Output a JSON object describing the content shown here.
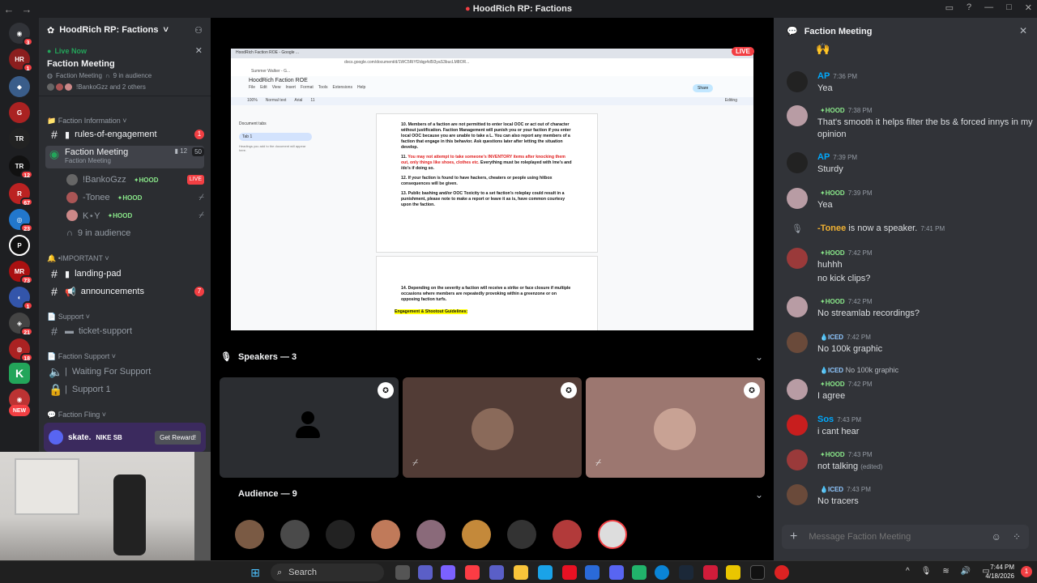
{
  "window": {
    "title": "HoodRich RP: Factions",
    "logo": "mic"
  },
  "server": {
    "name": "HoodRich RP: Factions",
    "chevron": "˅"
  },
  "live": {
    "label": "Live Now",
    "title": "Faction Meeting",
    "channel": "Faction Meeting",
    "audience": "9 in audience",
    "others": "!BankoGzz and 2 others"
  },
  "categories": {
    "faction_info": "Faction Information",
    "important": "•IMPORTANT",
    "support": "Support",
    "faction_support": "Faction Support",
    "faction_fling": "Faction Fling"
  },
  "channels": {
    "rules": {
      "name": "rules-of-engagement",
      "badge": "1"
    },
    "meeting": {
      "name": "Faction Meeting",
      "sub": "Faction Meeting",
      "count1": "12",
      "count2": "50"
    },
    "landing": {
      "name": "landing-pad"
    },
    "announcements": {
      "name": "announcements",
      "badge": "7"
    },
    "ticket": {
      "name": "ticket-support"
    },
    "waiting": {
      "name": "Waiting For Support"
    },
    "support1": {
      "name": "Support 1"
    }
  },
  "voice_users": [
    {
      "name": "!BankoGzz",
      "tag": "HOOD",
      "badge": "LIVE"
    },
    {
      "name": "-Tonee",
      "tag": "HOOD"
    },
    {
      "name": "K⋆Y",
      "tag": "HOOD"
    }
  ],
  "voice_audience": "9 in audience",
  "promo": {
    "brand": "skate.",
    "partner": "NIKE SB",
    "button": "Get Reward!"
  },
  "rail_badges": [
    "3",
    "1",
    "12",
    "67",
    "23",
    "73",
    "1",
    "21",
    "18",
    "NEW"
  ],
  "stage": {
    "live_badge": "LIVE",
    "speakers_label": "Speakers — 3",
    "audience_label": "Audience — 9"
  },
  "doc": {
    "url": "docs.google.com/document/d/1WC5RiYf2dqp4d5l3yaS3bucLM8OR...",
    "tab": "HoodRich Faction ROE - Google ...",
    "bookmark": "Summer Walker - G...",
    "title": "HoodRich Faction ROE",
    "menu": [
      "File",
      "Edit",
      "View",
      "Insert",
      "Format",
      "Tools",
      "Extensions",
      "Help"
    ],
    "share": "Share",
    "editing": "Editing",
    "zoom": "100%",
    "style": "Normal text",
    "font": "Arial",
    "fontsize": "11",
    "sidebar_title": "Document tabs",
    "sidebar_tab": "Tab 1",
    "sidebar_note": "Headings you add to the document will appear here.",
    "items": [
      {
        "n": "10.",
        "t": "Members of a faction are not permitted to enter local OOC or act out of character without justification. Faction Management will punish you or your faction if you enter local OOC because you are unable to take a L. You can also report any members of a faction that engage in this behavior. Ask questions later after letting the situation develop.",
        "red": ""
      },
      {
        "n": "11.",
        "red": "You may not attempt to take someone's INVENTORY items after knocking them out, only things like shoes, clothes etc.",
        "t": " Everything must be roleplayed with /me's and /do's if doing so."
      },
      {
        "n": "12.",
        "t": "If your faction is found to have hackers, cheaters or people using hitbox consequences will be given.",
        "red": ""
      },
      {
        "n": "13.",
        "t": "Public bashing and/or OOC Toxicity to a set faction's roleplay could result in a punishment, please note to make a report or leave it as is, have common courtesy upon the faction.",
        "red": ""
      },
      {
        "n": "14.",
        "t": "Depending on the severity a faction will receive a strike or face closure if multiple occasions where members are repeatedly provoking within a greenzone or on opposing faction turfs.",
        "red": ""
      }
    ],
    "heading": "Engagement & Shootout Guidelines:"
  },
  "chat": {
    "title": "Faction Meeting",
    "input_placeholder": "Message Faction Meeting",
    "messages": [
      {
        "name": "AP",
        "time": "7:36 PM",
        "text": "Yea",
        "color": "#00a8fc"
      },
      {
        "name": "",
        "tag": "HOOD",
        "time": "7:38 PM",
        "text": "That's smooth it helps filter the bs & forced innys in my opinion"
      },
      {
        "name": "AP",
        "time": "7:39 PM",
        "text": "Sturdy",
        "color": "#00a8fc"
      },
      {
        "name": "",
        "tag": "HOOD",
        "time": "7:39 PM",
        "text": "Yea"
      },
      {
        "name": "-Tonee",
        "text": " is now a speaker.",
        "time": "7:41 PM"
      },
      {
        "name": "",
        "tag": "HOOD",
        "time": "7:42 PM",
        "text": "huhhh",
        "text2": "no kick clips?"
      },
      {
        "name": "",
        "tag": "HOOD",
        "time": "7:42 PM",
        "text": "No streamlab recordings?"
      },
      {
        "name": "",
        "tag": "ICED",
        "time": "7:42 PM",
        "text": "No 100k graphic"
      },
      {
        "reply_tag": "ICED",
        "reply_text": "No 100k graphic",
        "name": "",
        "tag": "HOOD",
        "time": "7:42 PM",
        "text": "I agree"
      },
      {
        "name": "Sos",
        "time": "7:43 PM",
        "text": "i cant hear",
        "color": "#00a8fc"
      },
      {
        "name": "",
        "tag": "HOOD",
        "time": "7:43 PM",
        "text": "not talking",
        "edited": "(edited)"
      },
      {
        "name": "",
        "tag": "ICED",
        "time": "7:43 PM",
        "text": "No tracers"
      }
    ]
  },
  "taskbar": {
    "search": "Search",
    "time": "7:44 PM",
    "date": "4/18/2026",
    "badge": "1"
  }
}
